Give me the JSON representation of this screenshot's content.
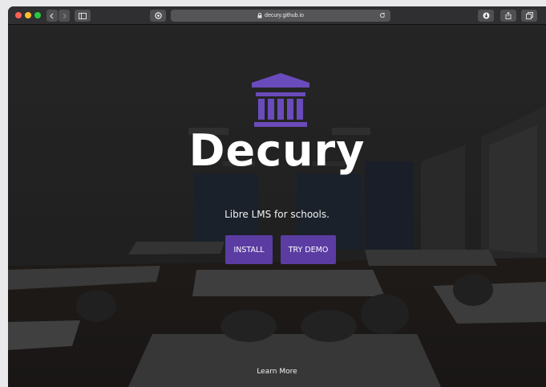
{
  "browser": {
    "url": "decury.github.io",
    "buttons": {
      "back": "chevron-left",
      "forward": "chevron-right",
      "sidebar": "sidebar-toggle",
      "privacy": "shield",
      "reload": "reload",
      "downloads": "download",
      "share": "share",
      "tabs": "tab-overview"
    }
  },
  "hero": {
    "logo_icon": "temple-icon",
    "brand": "Decury",
    "tagline": "Libre LMS for schools.",
    "install_label": "INSTALL",
    "demo_label": "TRY DEMO",
    "learn_more": "Learn More"
  },
  "colors": {
    "accent": "#5b3ca2",
    "logo": "#6a4bbb",
    "overlay": "#1e1e1e"
  }
}
